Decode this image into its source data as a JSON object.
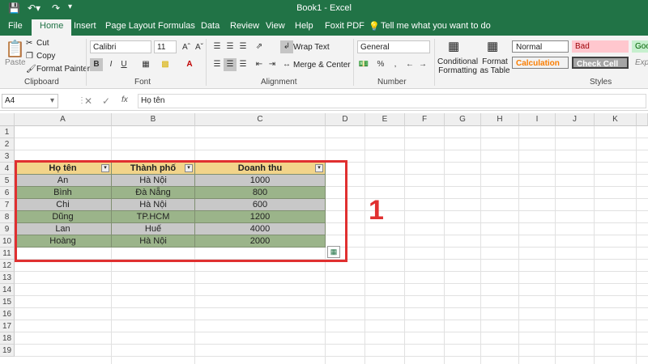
{
  "window": {
    "title": "Book1 - Excel"
  },
  "tabs": [
    "File",
    "Home",
    "Insert",
    "Page Layout",
    "Formulas",
    "Data",
    "Review",
    "View",
    "Help",
    "Foxit PDF"
  ],
  "tell_me": "Tell me what you want to do",
  "clipboard": {
    "paste": "Paste",
    "cut": "Cut",
    "copy": "Copy",
    "format_painter": "Format Painter",
    "label": "Clipboard"
  },
  "font": {
    "name": "Calibri",
    "size": "11",
    "label": "Font"
  },
  "alignment": {
    "wrap": "Wrap Text",
    "merge": "Merge & Center",
    "label": "Alignment"
  },
  "number": {
    "format": "General",
    "label": "Number"
  },
  "styles": {
    "conditional": "Conditional Formatting",
    "format_table": "Format as Table",
    "normal": "Normal",
    "bad": "Bad",
    "good": "Goo",
    "calculation": "Calculation",
    "check_cell": "Check Cell",
    "explanatory": "Exp",
    "label": "Styles"
  },
  "formula_bar": {
    "name_box": "A4",
    "fx": "fx",
    "content": "Họ tên"
  },
  "columns": [
    "A",
    "B",
    "C",
    "D",
    "E",
    "F",
    "G",
    "H",
    "I",
    "J",
    "K"
  ],
  "rows": [
    "1",
    "2",
    "3",
    "4",
    "5",
    "6",
    "7",
    "8",
    "9",
    "10",
    "11",
    "12",
    "13",
    "14",
    "15",
    "16",
    "17",
    "18",
    "19"
  ],
  "table": {
    "headers": [
      "Họ tên",
      "Thành phố",
      "Doanh thu"
    ],
    "rows": [
      [
        "An",
        "Hà Nội",
        "1000"
      ],
      [
        "Bình",
        "Đà Nẵng",
        "800"
      ],
      [
        "Chi",
        "Hà Nội",
        "600"
      ],
      [
        "Dũng",
        "TP.HCM",
        "1200"
      ],
      [
        "Lan",
        "Huế",
        "4000"
      ],
      [
        "Hoàng",
        "Hà Nội",
        "2000"
      ]
    ]
  },
  "annotation": {
    "label": "1",
    "color": "#e03030"
  },
  "colors": {
    "excel_green": "#217346",
    "header_fill": "#f2d48a",
    "odd_fill": "#c8c8c8",
    "even_fill": "#9bb48a"
  }
}
